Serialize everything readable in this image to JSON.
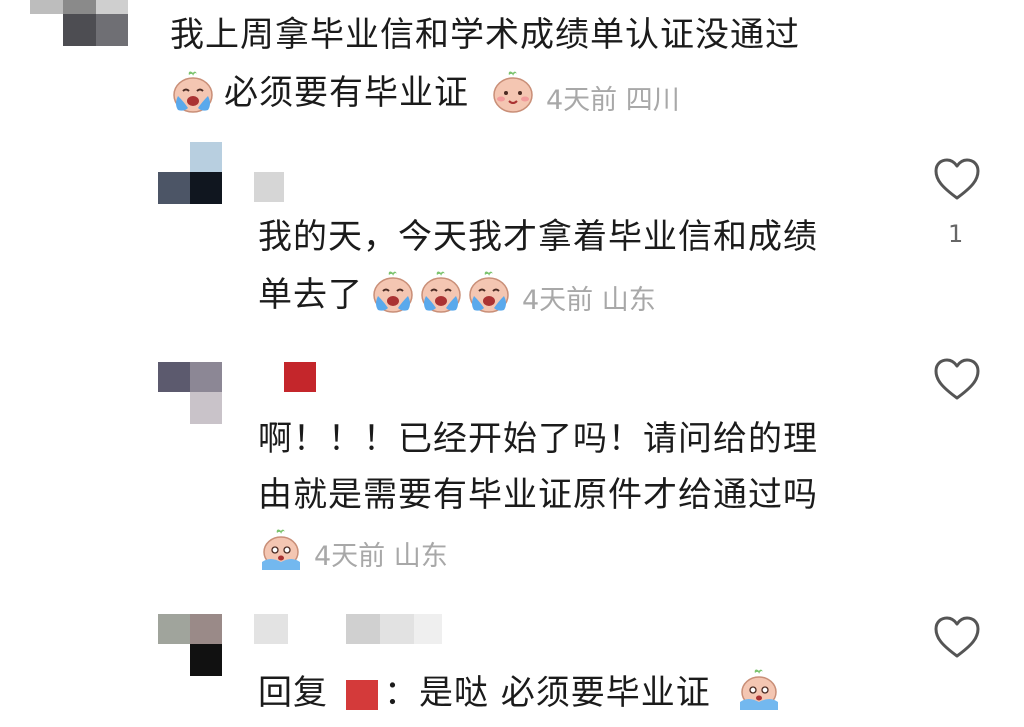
{
  "comments": [
    {
      "text": "我上周拿毕业信和学术成绩单认证没通过",
      "text2": "必须要有毕业证",
      "meta": "4天前 四川",
      "emojis": [
        "crying-face",
        "blush-face"
      ]
    },
    {
      "text_line1": "我的天，今天我才拿着毕业信和成绩",
      "text_line2": "单去了",
      "meta": "4天前 山东",
      "likes": "1",
      "emojis": [
        "crying-face",
        "crying-face",
        "crying-face"
      ]
    },
    {
      "text_line1": "啊！！！已经开始了吗！请问给的理",
      "text_line2": "由就是需要有毕业证原件才给通过吗",
      "meta": "4天前 山东",
      "emojis": [
        "sobbing-face"
      ]
    },
    {
      "reply_prefix": "回复",
      "text": "：是哒 必须要毕业证",
      "emojis": [
        "sobbing-face"
      ]
    }
  ],
  "colors": {
    "text": "#1b1b1b",
    "meta": "#a8a8a8",
    "redacted_name": "#cf2f2f",
    "heart_stroke": "#555555"
  },
  "icons": [
    "heart-icon",
    "crying-face-emoji",
    "blush-face-emoji",
    "sobbing-face-emoji"
  ]
}
